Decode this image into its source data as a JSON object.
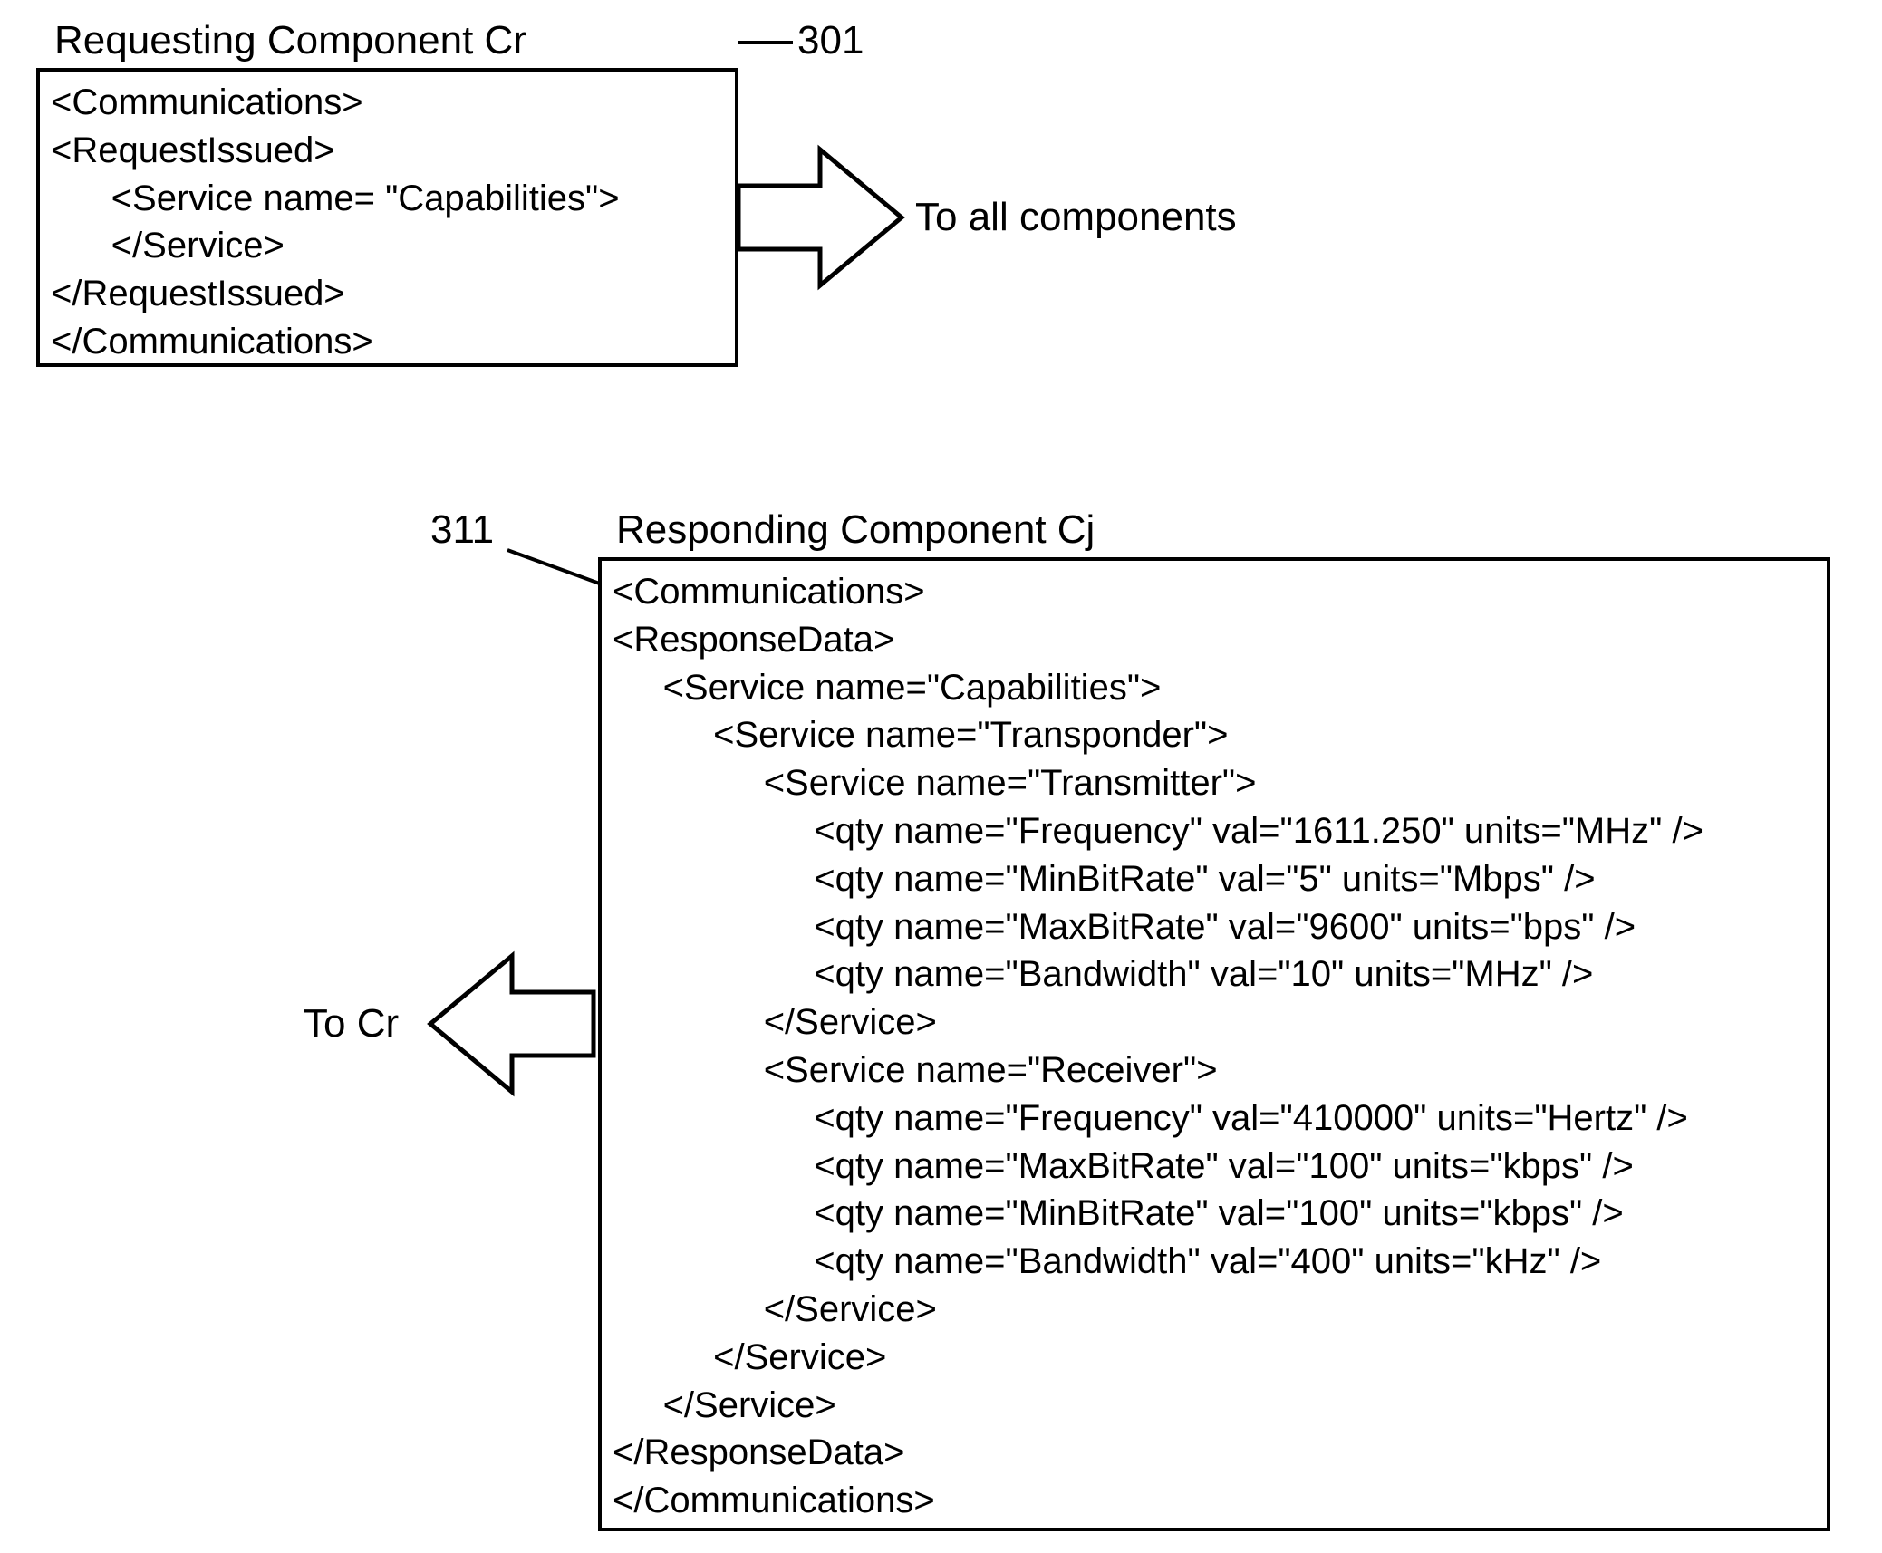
{
  "requesting": {
    "title": "Requesting Component Cr",
    "ref": "301",
    "arrow_label": "To all components",
    "code": "<Communications>\n<RequestIssued>\n      <Service name= \"Capabilities\">\n      </Service>\n</RequestIssued>\n</Communications>"
  },
  "responding": {
    "title": "Responding Component Cj",
    "ref": "311",
    "arrow_label": "To Cr",
    "code": "<Communications>\n<ResponseData>\n     <Service name=\"Capabilities\">\n          <Service name=\"Transponder\">\n               <Service name=\"Transmitter\">\n                    <qty name=\"Frequency\" val=\"1611.250\" units=\"MHz\" />\n                    <qty name=\"MinBitRate\" val=\"5\" units=\"Mbps\" />\n                    <qty name=\"MaxBitRate\" val=\"9600\" units=\"bps\" />\n                    <qty name=\"Bandwidth\" val=\"10\" units=\"MHz\" />\n               </Service>\n               <Service name=\"Receiver\">\n                    <qty name=\"Frequency\" val=\"410000\" units=\"Hertz\" />\n                    <qty name=\"MaxBitRate\" val=\"100\" units=\"kbps\" />\n                    <qty name=\"MinBitRate\" val=\"100\" units=\"kbps\" />\n                    <qty name=\"Bandwidth\" val=\"400\" units=\"kHz\" />\n               </Service>\n          </Service>\n     </Service>\n</ResponseData>\n</Communications>"
  }
}
